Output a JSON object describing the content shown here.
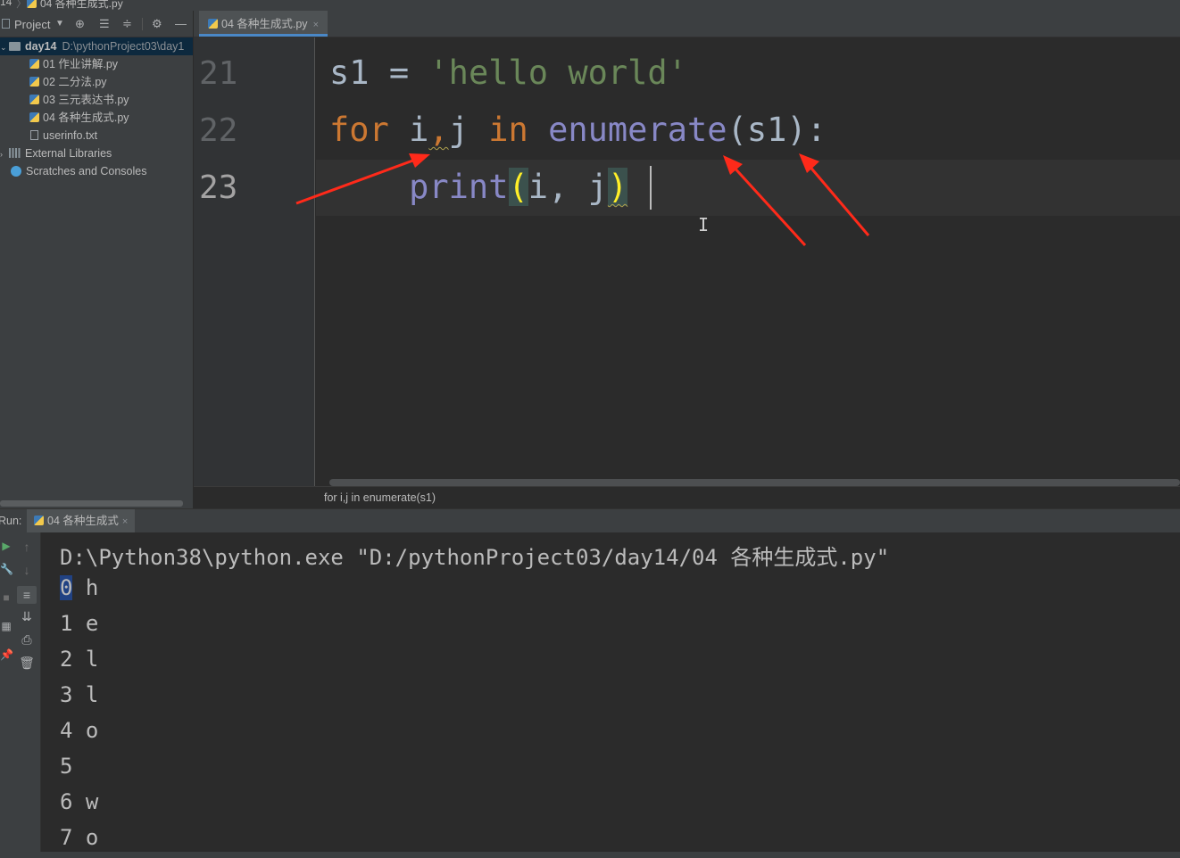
{
  "titlebar": {
    "crumb_folder": "14",
    "crumb_file": "04 各种生成式.py"
  },
  "project_panel": {
    "title": "Project",
    "icons": [
      "chevron-down-icon",
      "target-icon",
      "expand-all-icon",
      "collapse-all-icon",
      "gear-icon",
      "minimize-icon"
    ]
  },
  "tree": {
    "root": {
      "name": "day14",
      "path": "D:\\pythonProject03\\day1"
    },
    "files": [
      {
        "name": "01 作业讲解.py",
        "type": "py"
      },
      {
        "name": "02 二分法.py",
        "type": "py"
      },
      {
        "name": "03 三元表达书.py",
        "type": "py"
      },
      {
        "name": "04 各种生成式.py",
        "type": "py"
      },
      {
        "name": "userinfo.txt",
        "type": "txt"
      }
    ],
    "external_libraries": "External Libraries",
    "scratches": "Scratches and Consoles"
  },
  "editor": {
    "tab": {
      "label": "04 各种生成式.py",
      "close": "×"
    },
    "line_numbers": [
      "21",
      "22",
      "23"
    ],
    "code": {
      "l21": {
        "var": "s1",
        "op": " = ",
        "str": "'hello world'"
      },
      "l22": {
        "kw_for": "for",
        "i": "i",
        "comma": ",",
        "j": "j",
        "kw_in": "in",
        "fn": "enumerate",
        "args": "(s1):"
      },
      "l23": {
        "indent": "    ",
        "fn": "print",
        "lp": "(",
        "args": "i, j",
        "rp": ")"
      }
    },
    "breadcrumb": "for i,j in enumerate(s1)"
  },
  "annotation_color": "#ff2a1a",
  "run": {
    "label": "Run:",
    "tab": {
      "label": "04 各种生成式",
      "close": "×"
    },
    "command": "D:\\Python38\\python.exe \"D:/pythonProject03/day14/04 各种生成式.py\"",
    "output": [
      {
        "i": "0",
        "ch": "h"
      },
      {
        "i": "1",
        "ch": "e"
      },
      {
        "i": "2",
        "ch": "l"
      },
      {
        "i": "3",
        "ch": "l"
      },
      {
        "i": "4",
        "ch": "o"
      },
      {
        "i": "5",
        "ch": ""
      },
      {
        "i": "6",
        "ch": "w"
      },
      {
        "i": "7",
        "ch": "o"
      }
    ]
  }
}
